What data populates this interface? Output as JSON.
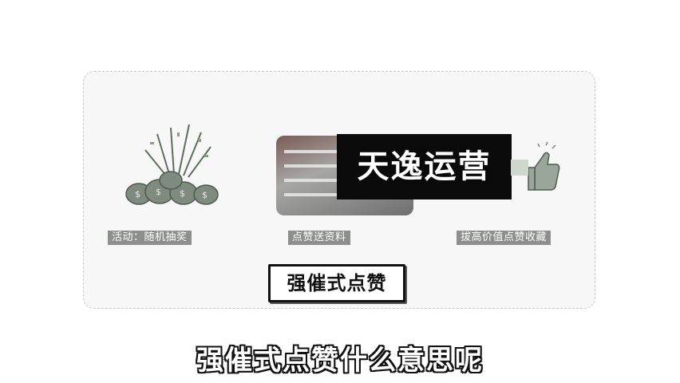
{
  "brand": {
    "text": "天逸运营"
  },
  "captions": {
    "left": "活动：随机抽奖",
    "middle": "点赞送资料",
    "right": "拔高价值点赞收藏"
  },
  "center_label": "强催式点赞",
  "subtitle": "强催式点赞什么意思呢",
  "icons": {
    "left": "money-bag-confetti-icon",
    "right": "thumbs-up-icon"
  }
}
